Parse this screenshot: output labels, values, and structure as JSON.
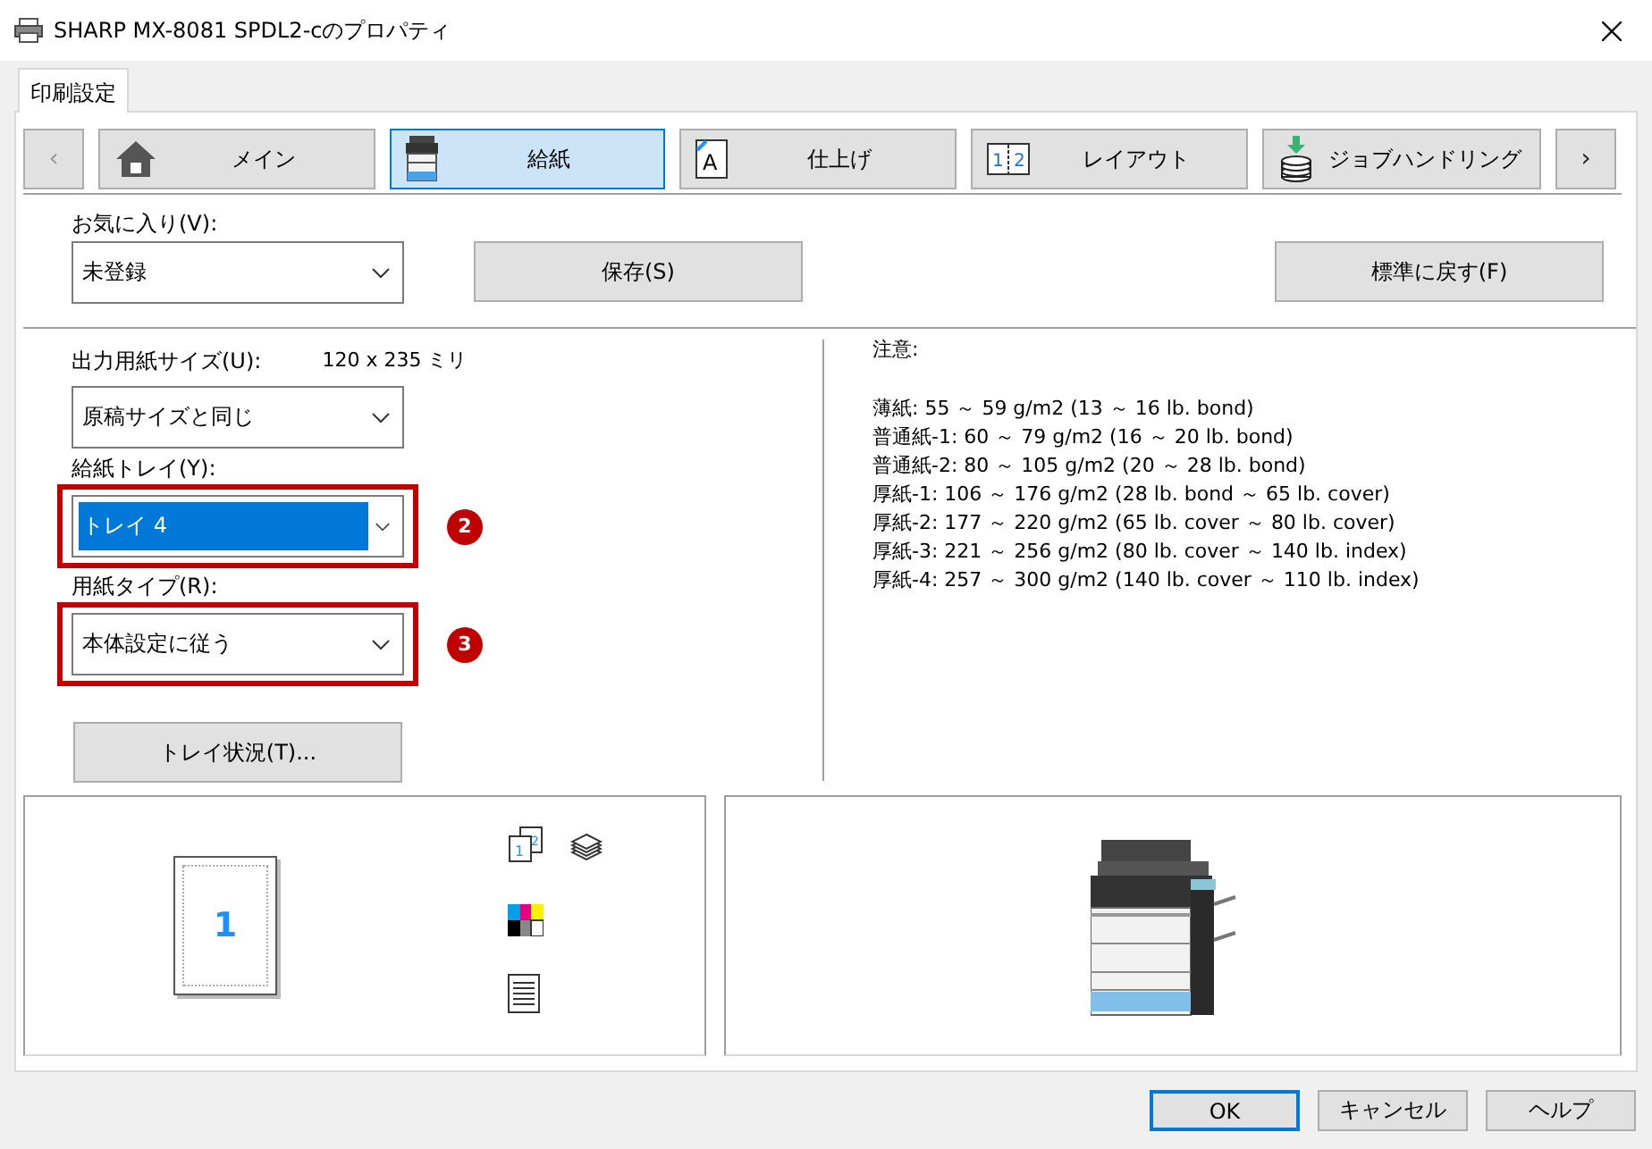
{
  "window": {
    "title": "SHARP MX-8081 SPDL2-cのプロパティ"
  },
  "tabs": [
    {
      "label": "印刷設定",
      "selected": true
    }
  ],
  "nav": {
    "scroll_left": {
      "label": "‹",
      "disabled": true
    },
    "scroll_right": {
      "label": "›",
      "disabled": false
    },
    "categories": [
      {
        "label": "メイン",
        "kind": "home",
        "selected": false
      },
      {
        "label": "給紙",
        "kind": "printer",
        "selected": true
      },
      {
        "label": "仕上げ",
        "kind": "page",
        "icon_texts": [
          "A"
        ],
        "selected": false
      },
      {
        "label": "レイアウト",
        "kind": "layout",
        "icon_texts": [
          "1",
          "2"
        ],
        "selected": false
      },
      {
        "label": "ジョブハンドリング",
        "kind": "stack",
        "selected": false
      }
    ]
  },
  "favorites": {
    "label": "お気に入り(V):",
    "value": "未登録",
    "save_button": "保存(S)",
    "reset_button": "標準に戻す(F)"
  },
  "paper": {
    "output_size": {
      "label": "出力用紙サイズ(U):",
      "reading": "120 x 235 ミリ",
      "value": "原稿サイズと同じ"
    },
    "tray": {
      "label": "給紙トレイ(Y):",
      "value": "トレイ 4",
      "value_selected": true,
      "highlighted": true,
      "callout": "2"
    },
    "type": {
      "label": "用紙タイプ(R):",
      "value": "本体設定に従う",
      "value_selected": false,
      "highlighted": true,
      "callout": "3"
    },
    "tray_status_button": "トレイ状況(T)..."
  },
  "notes": {
    "title": "注意:",
    "lines": [
      "薄紙: 55 ～ 59 g/m2 (13 ～ 16 lb. bond)",
      "普通紙-1: 60 ～ 79 g/m2 (16 ～ 20 lb. bond)",
      "普通紙-2: 80 ～ 105 g/m2 (20 ～ 28 lb. bond)",
      "厚紙-1: 106 ～ 176 g/m2 (28 lb. bond ～ 65 lb. cover)",
      "厚紙-2: 177 ～ 220 g/m2 (65 lb. cover ～ 80 lb. cover)",
      "厚紙-3: 221 ～ 256 g/m2 (80 lb. cover ～ 140 lb. index)",
      "厚紙-4: 257 ～ 300 g/m2 (140 lb. cover ～ 110 lb. index)"
    ]
  },
  "preview": {
    "page_number": "1",
    "duplex_icon_texts": [
      "1",
      "2"
    ]
  },
  "footer": {
    "buttons": [
      {
        "label": "OK",
        "default": true
      },
      {
        "label": "キャンセル",
        "default": false
      },
      {
        "label": "ヘルプ",
        "default": false
      }
    ]
  }
}
